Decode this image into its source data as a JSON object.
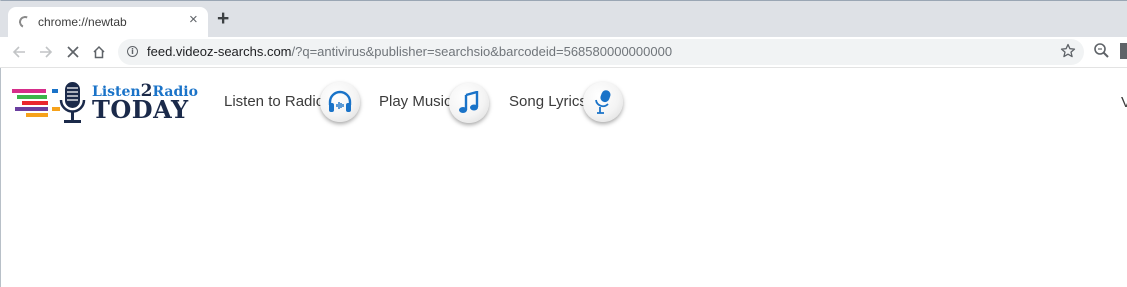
{
  "browser": {
    "tab": {
      "title": "chrome://newtab",
      "close_glyph": "×",
      "loading": true
    },
    "new_tab_glyph": "+",
    "address_bar": {
      "url_host": "feed.videoz-searchs.com",
      "url_rest": "/?q=antivirus&publisher=searchsio&barcodeid=568580000000000",
      "security_icon": "info-icon"
    }
  },
  "page": {
    "logo": {
      "top_text": "Listen",
      "digit": "2",
      "top_text_2": "Radio",
      "bottom_text": "TODAY",
      "icon": "microphone-icon"
    },
    "nav": [
      {
        "label": "Listen to Radio",
        "icon": "headphones-icon"
      },
      {
        "label": "Play Music",
        "icon": "music-note-icon"
      },
      {
        "label": "Song Lyrics",
        "icon": "microphone-icon"
      }
    ],
    "right_partial_text": "V"
  },
  "colors": {
    "accent_blue": "#1a73c8",
    "logo_navy": "#1b2a4a",
    "tabstrip": "#dee1e6"
  }
}
